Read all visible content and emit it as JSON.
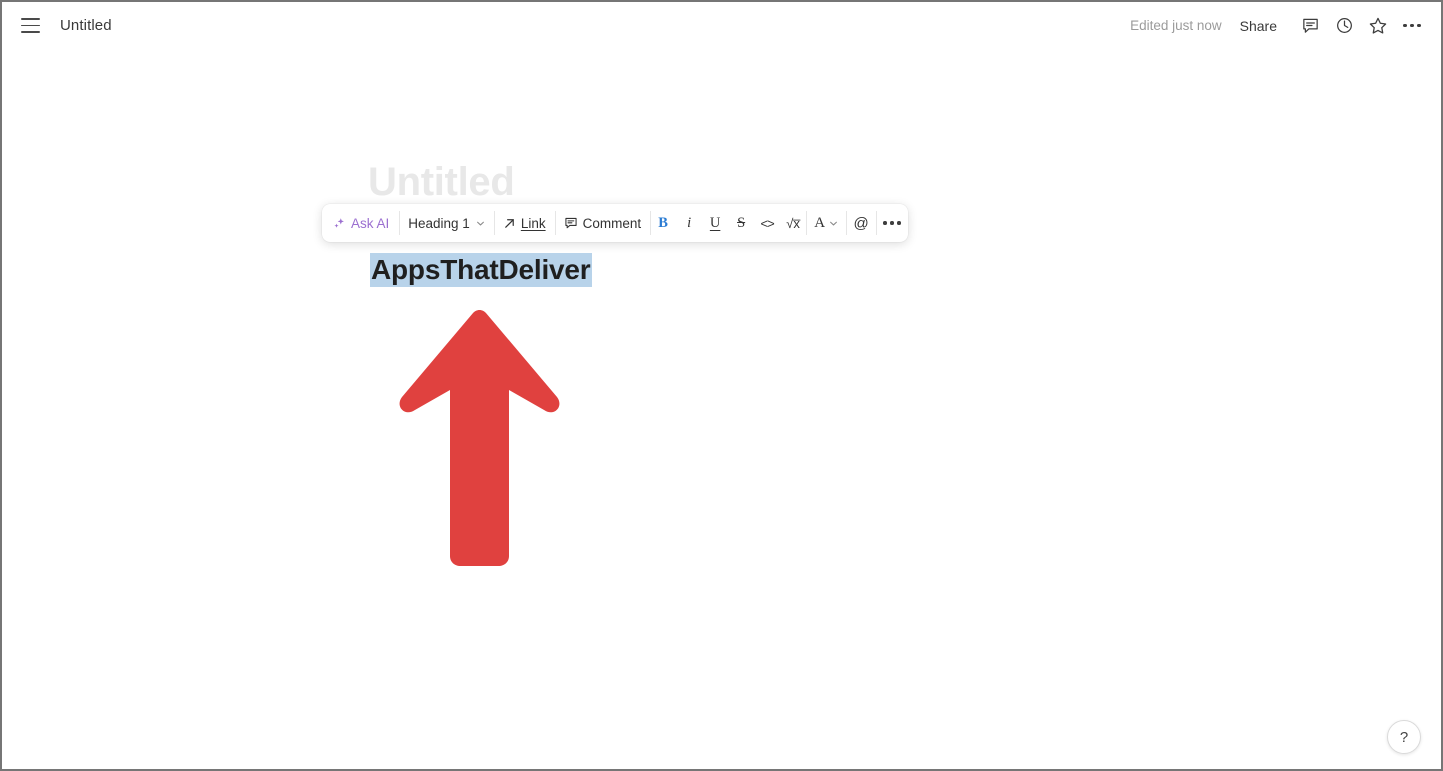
{
  "window": {
    "app": "document-editor"
  },
  "topbar": {
    "menu_icon": "hamburger-menu-icon",
    "doc_title": "Untitled",
    "edited_status": "Edited just now",
    "share_label": "Share",
    "icons": [
      {
        "name": "comment-icon",
        "label": "Comment"
      },
      {
        "name": "history-clock-icon",
        "label": "Version history"
      },
      {
        "name": "star-icon",
        "label": "Favorite"
      },
      {
        "name": "more-options-icon",
        "label": "More"
      }
    ]
  },
  "document": {
    "title_placeholder": "Untitled",
    "heading_text": "AppsThatDeliver",
    "selection_color": "#b8d3ea",
    "arrow": {
      "name": "red-up-arrow",
      "color": "#e0413f",
      "direction": "up"
    }
  },
  "format_toolbar": {
    "ask_ai": {
      "label": "Ask AI",
      "icon": "sparkle-icon",
      "color": "#9b6fd0"
    },
    "block_type": {
      "label": "Heading 1",
      "icon": "chevron-down-icon"
    },
    "link": {
      "label": "Link",
      "icon": "arrow-up-right-icon"
    },
    "comment": {
      "label": "Comment",
      "icon": "comment-bubble-icon"
    },
    "bold": {
      "label": "B",
      "active": true,
      "active_color": "#2b7cd3"
    },
    "italic": {
      "label": "i"
    },
    "underline": {
      "label": "U"
    },
    "strikethrough": {
      "label": "S"
    },
    "code": {
      "label": "<>"
    },
    "equation": {
      "label": "√x̅"
    },
    "text_color": {
      "label": "A",
      "icon": "chevron-down-icon"
    },
    "mention": {
      "label": "@"
    },
    "more": {
      "label": "…",
      "icon": "more-options-icon"
    }
  },
  "help": {
    "label": "?"
  }
}
